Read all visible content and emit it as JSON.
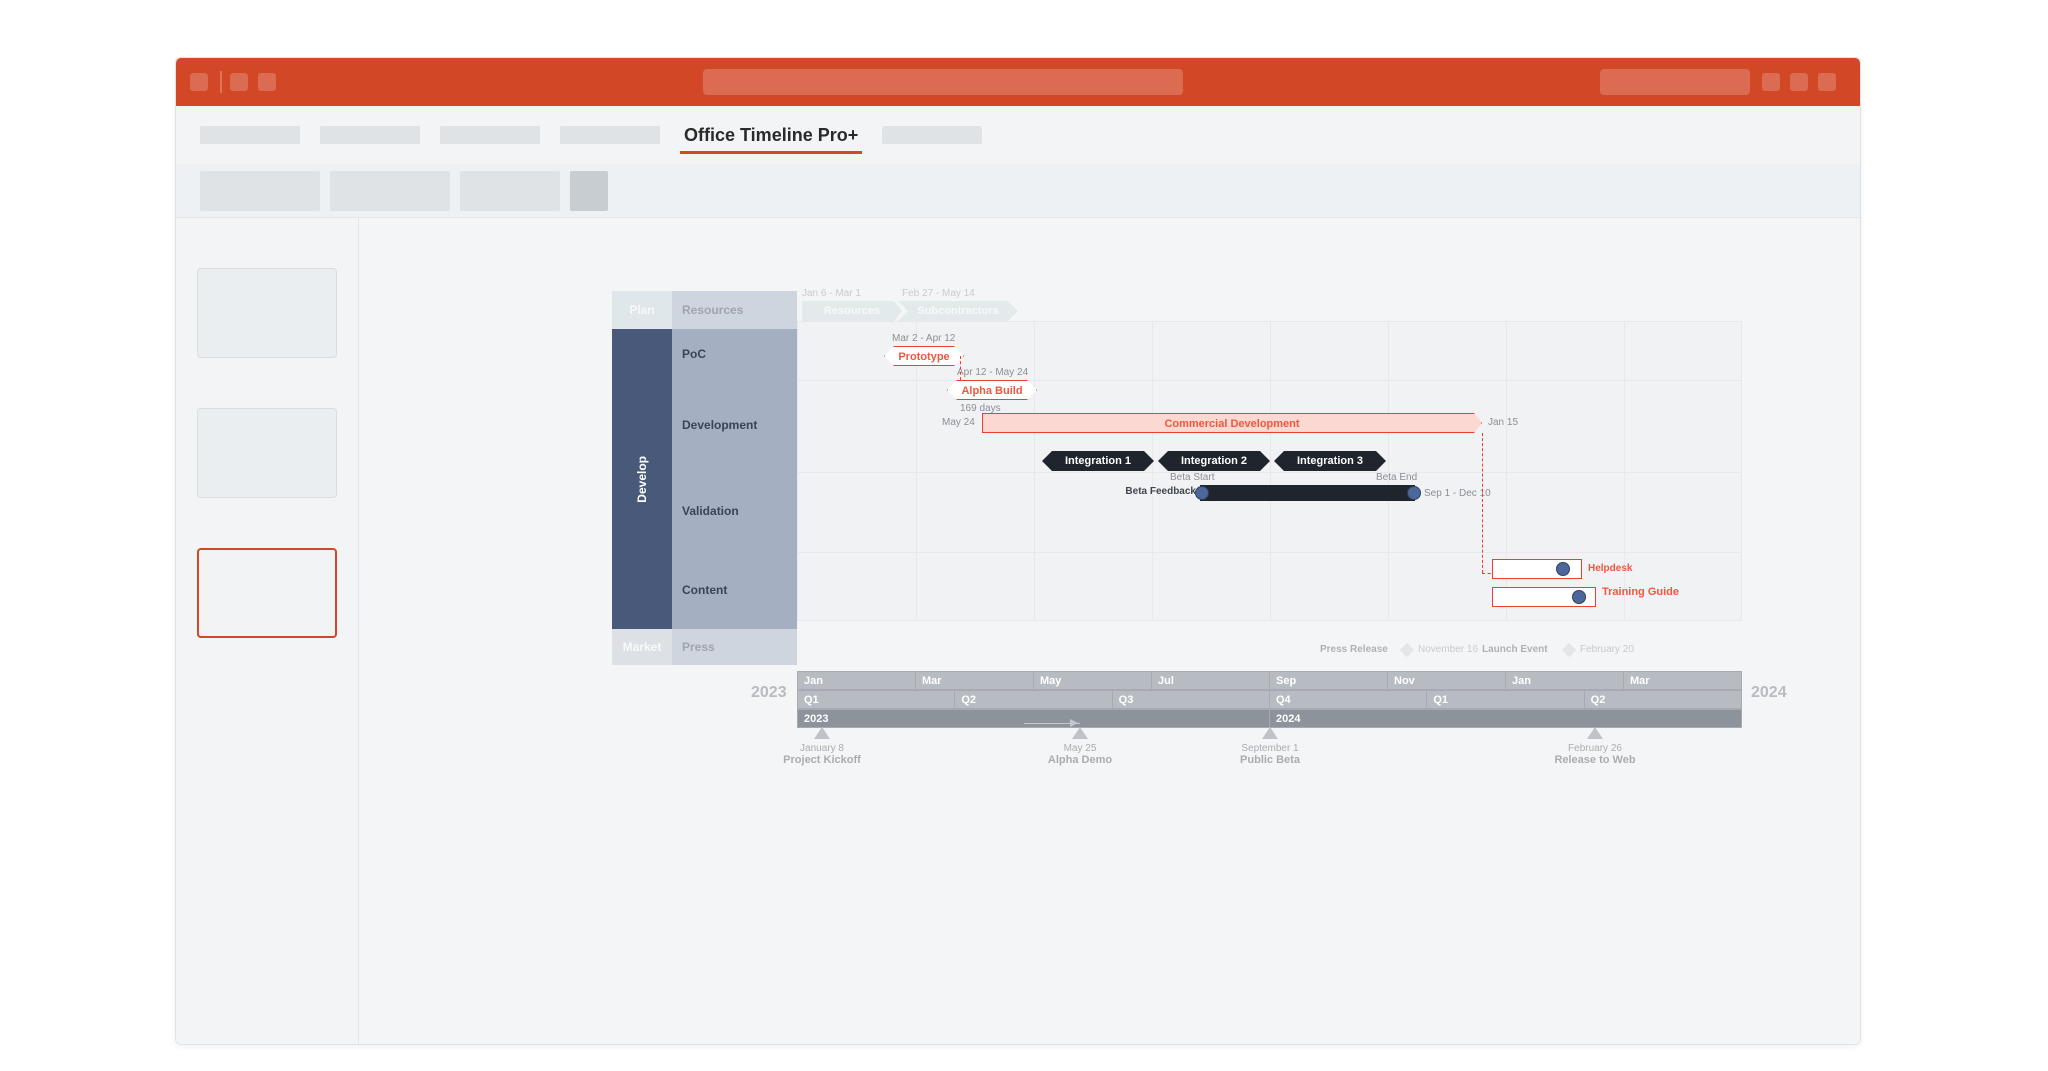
{
  "ribbon": {
    "active_tab": "Office Timeline Pro+"
  },
  "swimlanes": {
    "plan": {
      "label": "Plan",
      "rows": [
        "Resources"
      ]
    },
    "develop": {
      "label": "Develop",
      "rows": [
        "PoC",
        "Development",
        "Validation",
        "Content"
      ]
    },
    "market": {
      "label": "Market",
      "rows": [
        "Press"
      ]
    }
  },
  "tasks": {
    "resources": {
      "label": "Resources",
      "range": "Jan 6 - Mar 1"
    },
    "subcontractors": {
      "label": "Subcontractors",
      "range": "Feb 27 - May 14"
    },
    "prototype": {
      "label": "Prototype",
      "range": "Mar 2 - Apr 12"
    },
    "alpha_build": {
      "label": "Alpha Build",
      "range": "Apr 12 - May 24"
    },
    "commercial_dev": {
      "label": "Commercial Development",
      "start": "May 24",
      "end": "Jan 15",
      "duration": "169 days"
    },
    "integration1": {
      "label": "Integration 1"
    },
    "integration2": {
      "label": "Integration 2"
    },
    "integration3": {
      "label": "Integration 3"
    },
    "beta_feedback": {
      "label": "Beta Feedback",
      "start_lbl": "Beta Start",
      "end_lbl": "Beta End",
      "range": "Sep 1 - Dec 10"
    },
    "helpdesk": {
      "label": "Helpdesk"
    },
    "training_guide": {
      "label": "Training Guide"
    },
    "press_release": {
      "label": "Press Release",
      "date": "November 16"
    },
    "launch_event": {
      "label": "Launch Event",
      "date": "February 20"
    }
  },
  "axis": {
    "months": [
      "Jan",
      "Mar",
      "May",
      "Jul",
      "Sep",
      "Nov",
      "Jan",
      "Mar"
    ],
    "quarters": [
      "Q1",
      "Q2",
      "Q3",
      "Q4",
      "Q1",
      "Q2"
    ],
    "years": [
      "2023",
      "2024"
    ],
    "year_left": "2023",
    "year_right": "2024"
  },
  "milestones": [
    {
      "date": "January 8",
      "title": "Project Kickoff"
    },
    {
      "date": "May 25",
      "title": "Alpha Demo"
    },
    {
      "date": "September 1",
      "title": "Public Beta"
    },
    {
      "date": "February 26",
      "title": "Release to Web"
    }
  ],
  "chart_data": {
    "type": "gantt",
    "xrange": [
      "2023-01-01",
      "2024-04-30"
    ],
    "swimlanes": [
      {
        "name": "Plan",
        "rows": [
          {
            "name": "Resources",
            "tasks": [
              {
                "name": "Resources",
                "start": "2023-01-06",
                "end": "2023-03-01"
              },
              {
                "name": "Subcontractors",
                "start": "2023-02-27",
                "end": "2023-05-14"
              }
            ]
          }
        ]
      },
      {
        "name": "Develop",
        "rows": [
          {
            "name": "PoC",
            "tasks": [
              {
                "name": "Prototype",
                "start": "2023-03-02",
                "end": "2023-04-12"
              }
            ]
          },
          {
            "name": "Development",
            "tasks": [
              {
                "name": "Alpha Build",
                "start": "2023-04-12",
                "end": "2023-05-24"
              },
              {
                "name": "Commercial Development",
                "start": "2023-05-24",
                "end": "2024-01-15",
                "duration_days": 169
              }
            ]
          },
          {
            "name": "Validation",
            "tasks": [
              {
                "name": "Integration 1",
                "start": "2023-06-20",
                "end": "2023-07-31"
              },
              {
                "name": "Integration 2",
                "start": "2023-08-01",
                "end": "2023-09-10"
              },
              {
                "name": "Integration 3",
                "start": "2023-09-11",
                "end": "2023-10-25"
              },
              {
                "name": "Beta Feedback",
                "start": "2023-09-01",
                "end": "2023-12-10",
                "markers": [
                  {
                    "name": "Beta Start",
                    "date": "2023-09-01"
                  },
                  {
                    "name": "Beta End",
                    "date": "2023-12-10"
                  }
                ]
              }
            ]
          },
          {
            "name": "Content",
            "tasks": [
              {
                "name": "Helpdesk",
                "start": "2024-01-15",
                "end": "2024-02-25"
              },
              {
                "name": "Training Guide",
                "start": "2024-01-15",
                "end": "2024-03-04"
              }
            ]
          }
        ]
      },
      {
        "name": "Market",
        "rows": [
          {
            "name": "Press",
            "milestones": [
              {
                "name": "Press Release",
                "date": "2023-11-16"
              },
              {
                "name": "Launch Event",
                "date": "2024-02-20"
              }
            ]
          }
        ]
      }
    ],
    "timeline_milestones": [
      {
        "name": "Project Kickoff",
        "date": "2023-01-08"
      },
      {
        "name": "Alpha Demo",
        "date": "2023-05-25"
      },
      {
        "name": "Public Beta",
        "date": "2023-09-01"
      },
      {
        "name": "Release to Web",
        "date": "2024-02-26"
      }
    ]
  }
}
